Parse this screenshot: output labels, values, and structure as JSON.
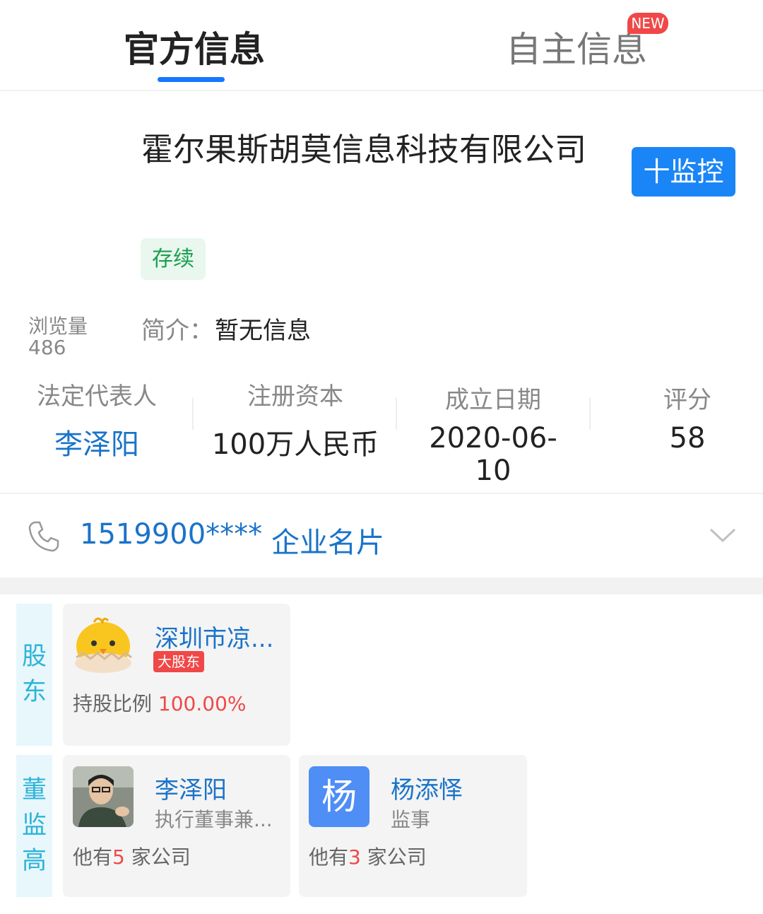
{
  "tabs": {
    "official": "官方信息",
    "self": "自主信息",
    "new_badge": "NEW"
  },
  "company": {
    "name": "霍尔果斯胡莫信息科技有限公司",
    "status": "存续",
    "monitor_label": "十监控"
  },
  "views": {
    "label": "浏览量",
    "value": "486"
  },
  "intro": {
    "label": "简介：",
    "value": "暂无信息"
  },
  "stats": [
    {
      "label": "法定代表人",
      "value": "李泽阳"
    },
    {
      "label": "注册资本",
      "value": "100万人民币"
    },
    {
      "label": "成立日期",
      "value": "2020-06-10"
    },
    {
      "label": "评分",
      "value": "58"
    }
  ],
  "contact": {
    "phone": "1519900****",
    "business_card": "企业名片"
  },
  "shareholders": {
    "section_label": [
      "股",
      "东"
    ],
    "items": [
      {
        "name": "深圳市凉...",
        "badge": "大股东",
        "ratio_label": "持股比例 ",
        "ratio_value": "100.00%"
      }
    ]
  },
  "executives": {
    "section_label": [
      "董",
      "监",
      "高"
    ],
    "items": [
      {
        "name": "李泽阳",
        "role": "执行董事兼...",
        "prefix": "他有",
        "count": "5",
        "suffix": " 家公司"
      },
      {
        "name": "杨添怿",
        "role": "监事",
        "avatar_letter": "杨",
        "prefix": "他有",
        "count": "3",
        "suffix": " 家公司"
      }
    ]
  },
  "colors": {
    "accent": "#1677ff",
    "link": "#1a73c9",
    "red": "#f04848",
    "status_green": "#1a9f4e"
  }
}
